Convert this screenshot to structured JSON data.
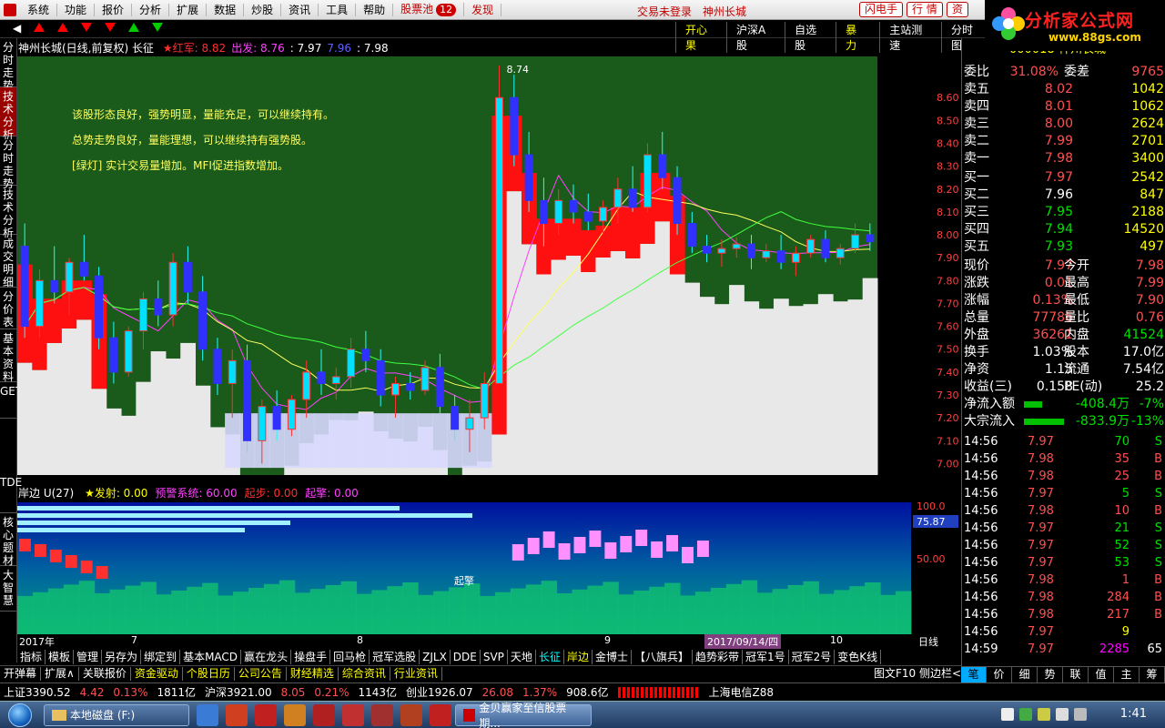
{
  "menu": {
    "items": [
      "系统",
      "功能",
      "报价",
      "分析",
      "扩展",
      "数据",
      "炒股",
      "资讯",
      "工具",
      "帮助"
    ],
    "stock_pool": "股票池",
    "stock_pool_count": "12",
    "discover": "发现",
    "login_status": "交易未登录",
    "stock_name": "神州长城",
    "buttons": [
      "闪电手",
      "行 情",
      "资"
    ]
  },
  "logo": {
    "title": "分析家公式网",
    "url": "www.88gs.com"
  },
  "toolbar": {
    "links": [
      "开心果",
      "沪深A股",
      "自选股",
      "暴 力",
      "主站测速",
      "分时图"
    ]
  },
  "left_tabs": [
    "分时走势",
    "技术分析",
    "分时走势",
    "技术分析",
    "成交明细",
    "分价表",
    "基本资料",
    "GET",
    "TDE",
    "核心题材",
    "大智慧"
  ],
  "chart": {
    "title": "神州长城(日线,前复权) 长征",
    "legend": [
      {
        "label": "★红军: 8.82",
        "color": "#ff3030"
      },
      {
        "label": "出发: 8.76",
        "color": "#ff40ff"
      },
      {
        "label": ": 7.97",
        "color": "#ffffff"
      },
      {
        "label": "7.96",
        "color": "#6060ff"
      },
      {
        "label": ": 7.98",
        "color": "#ffffff"
      }
    ],
    "notes": [
      "该股形态良好，强势明显，量能充足，可以继续持有。",
      "总势走势良好，量能理想，可以继续持有强势股。",
      "[绿灯] 实计交易量增加。MFI促进指数增加。"
    ],
    "peak_label": "8.74",
    "y_ticks": [
      "8.60",
      "8.50",
      "8.40",
      "8.30",
      "8.20",
      "8.10",
      "8.00",
      "7.90",
      "7.80",
      "7.70",
      "7.60",
      "7.50",
      "7.40",
      "7.30",
      "7.20",
      "7.10",
      "7.00"
    ],
    "y_range": [
      6.95,
      8.78
    ]
  },
  "chart_data": {
    "type": "candlestick",
    "title": "神州长城(日线,前复权) 长征",
    "ylim": [
      6.95,
      8.78
    ],
    "candles": [
      [
        7.95,
        8.05,
        7.55,
        7.6
      ],
      [
        7.6,
        7.85,
        7.55,
        7.8
      ],
      [
        7.8,
        7.95,
        7.7,
        7.75
      ],
      [
        7.75,
        7.9,
        7.65,
        7.88
      ],
      [
        7.88,
        8.0,
        7.8,
        7.82
      ],
      [
        7.82,
        7.86,
        7.5,
        7.55
      ],
      [
        7.55,
        7.62,
        7.35,
        7.4
      ],
      [
        7.4,
        7.6,
        7.38,
        7.58
      ],
      [
        7.58,
        7.75,
        7.5,
        7.72
      ],
      [
        7.72,
        7.8,
        7.6,
        7.65
      ],
      [
        7.65,
        7.92,
        7.6,
        7.88
      ],
      [
        7.88,
        7.95,
        7.7,
        7.75
      ],
      [
        7.75,
        7.82,
        7.45,
        7.5
      ],
      [
        7.5,
        7.55,
        7.3,
        7.35
      ],
      [
        7.35,
        7.5,
        7.2,
        7.45
      ],
      [
        7.45,
        7.52,
        7.05,
        7.1
      ],
      [
        7.1,
        7.28,
        7.0,
        7.25
      ],
      [
        7.25,
        7.32,
        7.1,
        7.15
      ],
      [
        7.15,
        7.3,
        7.12,
        7.28
      ],
      [
        7.28,
        7.45,
        7.2,
        7.4
      ],
      [
        7.4,
        7.5,
        7.3,
        7.35
      ],
      [
        7.35,
        7.42,
        7.28,
        7.38
      ],
      [
        7.38,
        7.55,
        7.33,
        7.5
      ],
      [
        7.5,
        7.58,
        7.4,
        7.45
      ],
      [
        7.45,
        7.5,
        7.25,
        7.3
      ],
      [
        7.3,
        7.38,
        7.2,
        7.35
      ],
      [
        7.35,
        7.4,
        7.28,
        7.32
      ],
      [
        7.32,
        7.45,
        7.3,
        7.42
      ],
      [
        7.42,
        7.48,
        7.22,
        7.25
      ],
      [
        7.25,
        7.3,
        7.1,
        7.15
      ],
      [
        7.15,
        7.28,
        7.05,
        7.2
      ],
      [
        7.2,
        7.4,
        7.15,
        7.35
      ],
      [
        7.35,
        8.74,
        7.35,
        8.6
      ],
      [
        8.6,
        8.7,
        8.3,
        8.35
      ],
      [
        8.35,
        8.45,
        8.1,
        8.15
      ],
      [
        8.15,
        8.25,
        7.95,
        8.05
      ],
      [
        8.05,
        8.2,
        8.0,
        8.15
      ],
      [
        8.15,
        8.22,
        8.05,
        8.1
      ],
      [
        8.1,
        8.18,
        8.02,
        8.06
      ],
      [
        8.06,
        8.15,
        8.0,
        8.12
      ],
      [
        8.12,
        8.25,
        8.05,
        8.2
      ],
      [
        8.2,
        8.3,
        8.1,
        8.12
      ],
      [
        8.12,
        8.4,
        8.1,
        8.35
      ],
      [
        8.35,
        8.45,
        8.2,
        8.25
      ],
      [
        8.25,
        8.3,
        8.0,
        8.05
      ],
      [
        8.05,
        8.1,
        7.92,
        7.95
      ],
      [
        7.95,
        8.0,
        7.88,
        7.92
      ],
      [
        7.92,
        7.98,
        7.86,
        7.94
      ],
      [
        7.94,
        7.99,
        7.9,
        7.96
      ],
      [
        7.96,
        8.0,
        7.85,
        7.9
      ],
      [
        7.9,
        7.96,
        7.88,
        7.93
      ],
      [
        7.93,
        8.0,
        7.85,
        7.88
      ],
      [
        7.88,
        7.95,
        7.82,
        7.92
      ],
      [
        7.92,
        8.0,
        7.9,
        7.98
      ],
      [
        7.98,
        8.02,
        7.88,
        7.9
      ],
      [
        7.9,
        7.96,
        7.87,
        7.94
      ],
      [
        7.94,
        8.05,
        7.92,
        8.0
      ],
      [
        8.0,
        8.05,
        7.93,
        7.97
      ]
    ],
    "y_ticks": [
      8.6,
      8.5,
      8.4,
      8.3,
      8.2,
      8.1,
      8.0,
      7.9,
      7.8,
      7.7,
      7.6,
      7.5,
      7.4,
      7.3,
      7.2,
      7.1,
      7.0
    ]
  },
  "indicator": {
    "title": "岸边 U(27)",
    "signals": [
      {
        "label": "★发射: 0.00",
        "color": "#ffff00"
      },
      {
        "label": "预警系统: 60.00",
        "color": "#ff40ff"
      },
      {
        "label": "起步: 0.00",
        "color": "#ff3030"
      },
      {
        "label": "起擎: 0.00",
        "color": "#ff40ff"
      }
    ],
    "y_ticks": [
      "100.0",
      "75.87",
      "50.00"
    ],
    "marker": "起擎"
  },
  "date_axis": [
    "2017年",
    "7",
    "8",
    "9",
    "2017/09/14/四",
    "10",
    "日线"
  ],
  "bottom_tabs": [
    "指标",
    "模板",
    "管理",
    "另存为",
    "绑定到",
    "基本MACD",
    "赢在龙头",
    "操盘手",
    "回马枪",
    "冠军选股",
    "ZJLX",
    "DDE",
    "SVP",
    "天地",
    "长征",
    "岸边",
    "金博士",
    "【八旗兵】",
    "趋势彩带",
    "冠军1号",
    "冠军2号",
    "变色K线"
  ],
  "sub_tabs": [
    "开弹幕",
    "扩展∧",
    "关联报价",
    "资金驱动",
    "个股日历",
    "公司公告",
    "财经精选",
    "综合资讯",
    "行业资讯"
  ],
  "sub_tabs_right": "图文F10  侧边栏<",
  "quote": {
    "code": "000018",
    "name": "神州长城",
    "weibi": "31.08%",
    "weicha": "9765",
    "asks": [
      {
        "label": "卖五",
        "price": "8.02",
        "vol": "1042"
      },
      {
        "label": "卖四",
        "price": "8.01",
        "vol": "1062"
      },
      {
        "label": "卖三",
        "price": "8.00",
        "vol": "2624"
      },
      {
        "label": "卖二",
        "price": "7.99",
        "vol": "2701"
      },
      {
        "label": "卖一",
        "price": "7.98",
        "vol": "3400"
      }
    ],
    "bids": [
      {
        "label": "买一",
        "price": "7.97",
        "vol": "2542"
      },
      {
        "label": "买二",
        "price": "7.96",
        "vol": "847"
      },
      {
        "label": "买三",
        "price": "7.95",
        "vol": "2188"
      },
      {
        "label": "买四",
        "price": "7.94",
        "vol": "14520"
      },
      {
        "label": "买五",
        "price": "7.93",
        "vol": "497"
      }
    ],
    "stats": [
      [
        "现价",
        "7.97",
        "今开",
        "7.98"
      ],
      [
        "涨跌",
        "0.01",
        "最高",
        "7.99"
      ],
      [
        "涨幅",
        "0.13%",
        "最低",
        "7.90"
      ],
      [
        "总量",
        "77786",
        "量比",
        "0.76"
      ],
      [
        "外盘",
        "36261",
        "内盘",
        "41524"
      ],
      [
        "换手",
        "1.03%",
        "股本",
        "17.0亿"
      ],
      [
        "净资",
        "1.15",
        "流通",
        "7.54亿"
      ],
      [
        "收益(三)",
        "0.158",
        "PE(动)",
        "25.2"
      ]
    ],
    "flows": [
      {
        "label": "净流入额",
        "value": "-408.4万",
        "pct": "-7%"
      },
      {
        "label": "大宗流入",
        "value": "-833.9万",
        "pct": "-13%"
      }
    ]
  },
  "ticks": [
    [
      "14:56",
      "7.97",
      "70",
      "S"
    ],
    [
      "14:56",
      "7.98",
      "35",
      "B"
    ],
    [
      "14:56",
      "7.98",
      "25",
      "B"
    ],
    [
      "14:56",
      "7.97",
      "5",
      "S"
    ],
    [
      "14:56",
      "7.98",
      "10",
      "B"
    ],
    [
      "14:56",
      "7.97",
      "21",
      "S"
    ],
    [
      "14:56",
      "7.97",
      "52",
      "S"
    ],
    [
      "14:56",
      "7.97",
      "53",
      "S"
    ],
    [
      "14:56",
      "7.98",
      "1",
      "B"
    ],
    [
      "14:56",
      "7.98",
      "284",
      "B"
    ],
    [
      "14:56",
      "7.98",
      "217",
      "B"
    ],
    [
      "14:56",
      "7.97",
      "9",
      ""
    ],
    [
      "14:59",
      "7.97",
      "2285",
      "65"
    ]
  ],
  "rp_tabs": [
    "笔",
    "价",
    "细",
    "势",
    "联",
    "值",
    "主",
    "筹"
  ],
  "status": {
    "sh": "上证3390.52",
    "sh_chg": "4.42",
    "sh_pct": "0.13%",
    "sh_amt": "1811亿",
    "sz": "沪深3921.00",
    "sz_chg": "8.05",
    "sz_pct": "0.21%",
    "sz_amt": "1143亿",
    "cy": "创业1926.07",
    "cy_chg": "26.08",
    "cy_pct": "1.37%",
    "cy_amt": "908.6亿",
    "server": "上海电信Z88"
  },
  "taskbar": {
    "folder": "本地磁盘 (F:)",
    "app": "金贝赢家至信股票期...",
    "time": "1:41"
  }
}
